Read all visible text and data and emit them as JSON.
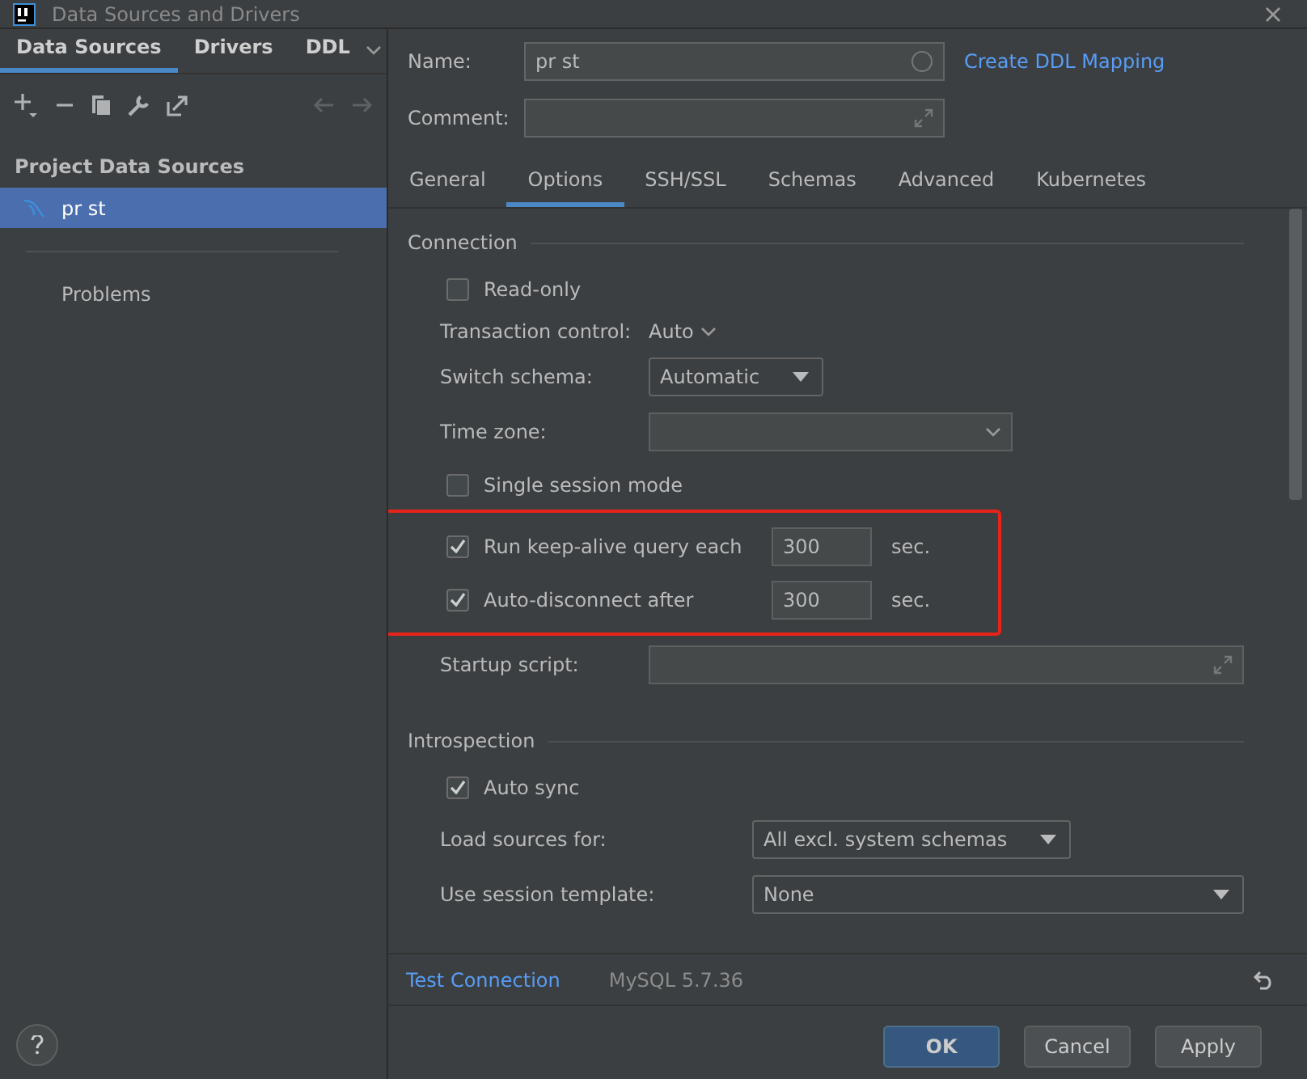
{
  "window": {
    "title": "Data Sources and Drivers"
  },
  "sidebar": {
    "tabs": [
      {
        "label": "Data Sources",
        "selected": true
      },
      {
        "label": "Drivers",
        "selected": false
      },
      {
        "label": "DDL",
        "selected": false
      }
    ],
    "section_title": "Project Data Sources",
    "items": [
      {
        "label": "pr st",
        "selected": true
      }
    ],
    "problems": "Problems"
  },
  "form": {
    "name_label": "Name:",
    "name_value": "pr st",
    "link": "Create DDL Mapping",
    "comment_label": "Comment:"
  },
  "tabs": [
    {
      "label": "General",
      "selected": false
    },
    {
      "label": "Options",
      "selected": true
    },
    {
      "label": "SSH/SSL",
      "selected": false
    },
    {
      "label": "Schemas",
      "selected": false
    },
    {
      "label": "Advanced",
      "selected": false
    },
    {
      "label": "Kubernetes",
      "selected": false
    }
  ],
  "sections": [
    {
      "title": "Connection",
      "rows": [
        {
          "kind": "checkbox",
          "label": "Read-only",
          "checked": false
        },
        {
          "kind": "inline",
          "label": "Transaction control:",
          "value": "Auto"
        },
        {
          "kind": "select",
          "label": "Switch schema:",
          "value": "Automatic"
        },
        {
          "kind": "combo",
          "label": "Time zone:"
        },
        {
          "kind": "checkbox",
          "label": "Single session mode",
          "checked": false
        },
        {
          "kind": "number",
          "label": "Run keep-alive query each",
          "checked": true,
          "value": "300",
          "unit": "sec.",
          "highlighted": true
        },
        {
          "kind": "number",
          "label": "Auto-disconnect after",
          "checked": true,
          "value": "300",
          "unit": "sec.",
          "highlighted": true
        },
        {
          "kind": "area",
          "label": "Startup script:"
        }
      ]
    },
    {
      "title": "Introspection",
      "rows": [
        {
          "kind": "checkbox",
          "label": "Auto sync",
          "checked": true
        },
        {
          "kind": "select",
          "label": "Load sources for:",
          "value": "All excl. system schemas"
        },
        {
          "kind": "wide",
          "label": "Use session template:",
          "value": "None"
        }
      ]
    }
  ],
  "footer": {
    "link": "Test Connection",
    "version": "MySQL 5.7.36"
  },
  "buttons": [
    {
      "label": "OK",
      "kind": "primary"
    },
    {
      "label": "Cancel",
      "kind": "normal"
    },
    {
      "label": "Apply",
      "kind": "normal"
    }
  ]
}
